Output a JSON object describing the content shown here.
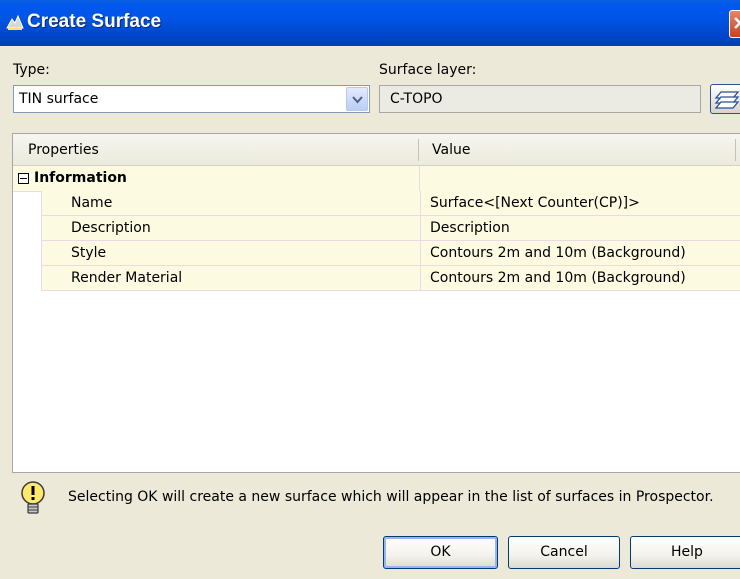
{
  "window": {
    "title": "Create Surface"
  },
  "type": {
    "label": "Type:",
    "value": "TIN surface"
  },
  "layer": {
    "label": "Surface layer:",
    "value": "C-TOPO"
  },
  "grid": {
    "headers": {
      "properties": "Properties",
      "value": "Value"
    },
    "category": "Information",
    "rows": [
      {
        "name": "Name",
        "value": "Surface<[Next Counter(CP)]>"
      },
      {
        "name": "Description",
        "value": "Description"
      },
      {
        "name": "Style",
        "value": "Contours 2m and 10m (Background)"
      },
      {
        "name": "Render Material",
        "value": "Contours 2m and 10m (Background)"
      }
    ]
  },
  "info": {
    "message": "Selecting OK will create a new surface which will appear in the list of surfaces in Prospector."
  },
  "buttons": {
    "ok": "OK",
    "cancel": "Cancel",
    "help": "Help"
  },
  "colors": {
    "titlebar": "#0055e5",
    "dialog_bg": "#ece9d8",
    "row_bg": "#fdfae2",
    "border_blue": "#003c74"
  }
}
